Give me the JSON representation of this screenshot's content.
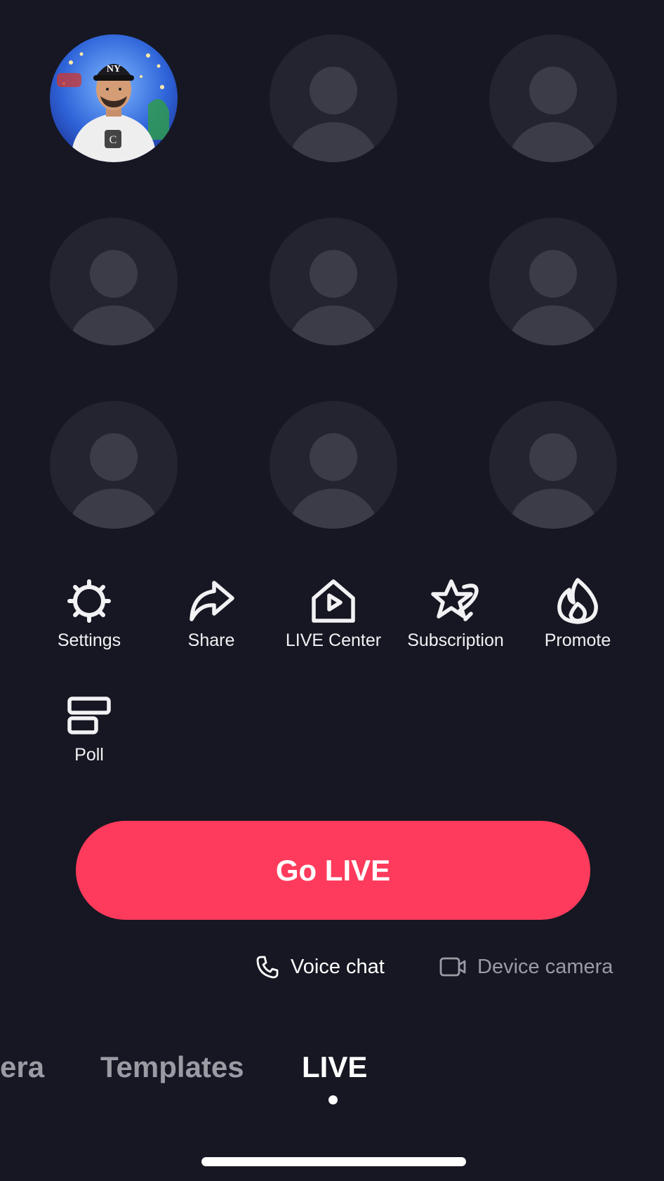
{
  "guest_grid": {
    "host_avatar": "host-avatar",
    "empty_slots": 8
  },
  "tools": [
    {
      "label": "Settings",
      "icon": "gear-icon"
    },
    {
      "label": "Share",
      "icon": "share-arrow-icon"
    },
    {
      "label": "LIVE Center",
      "icon": "live-center-house-icon"
    },
    {
      "label": "Subscription",
      "icon": "star-icon"
    },
    {
      "label": "Promote",
      "icon": "flame-icon"
    },
    {
      "label": "Poll",
      "icon": "poll-icon"
    }
  ],
  "go_live_label": "Go LIVE",
  "modes": {
    "voice_chat": "Voice chat",
    "device_camera": "Device camera"
  },
  "bottom_tabs": [
    {
      "label": "era"
    },
    {
      "label": "Templates"
    },
    {
      "label": "LIVE",
      "active": true
    }
  ],
  "colors": {
    "background": "#161722",
    "accent": "#fe3b5c",
    "placeholder_circle": "#23242f",
    "placeholder_figure": "#3b3c47"
  }
}
